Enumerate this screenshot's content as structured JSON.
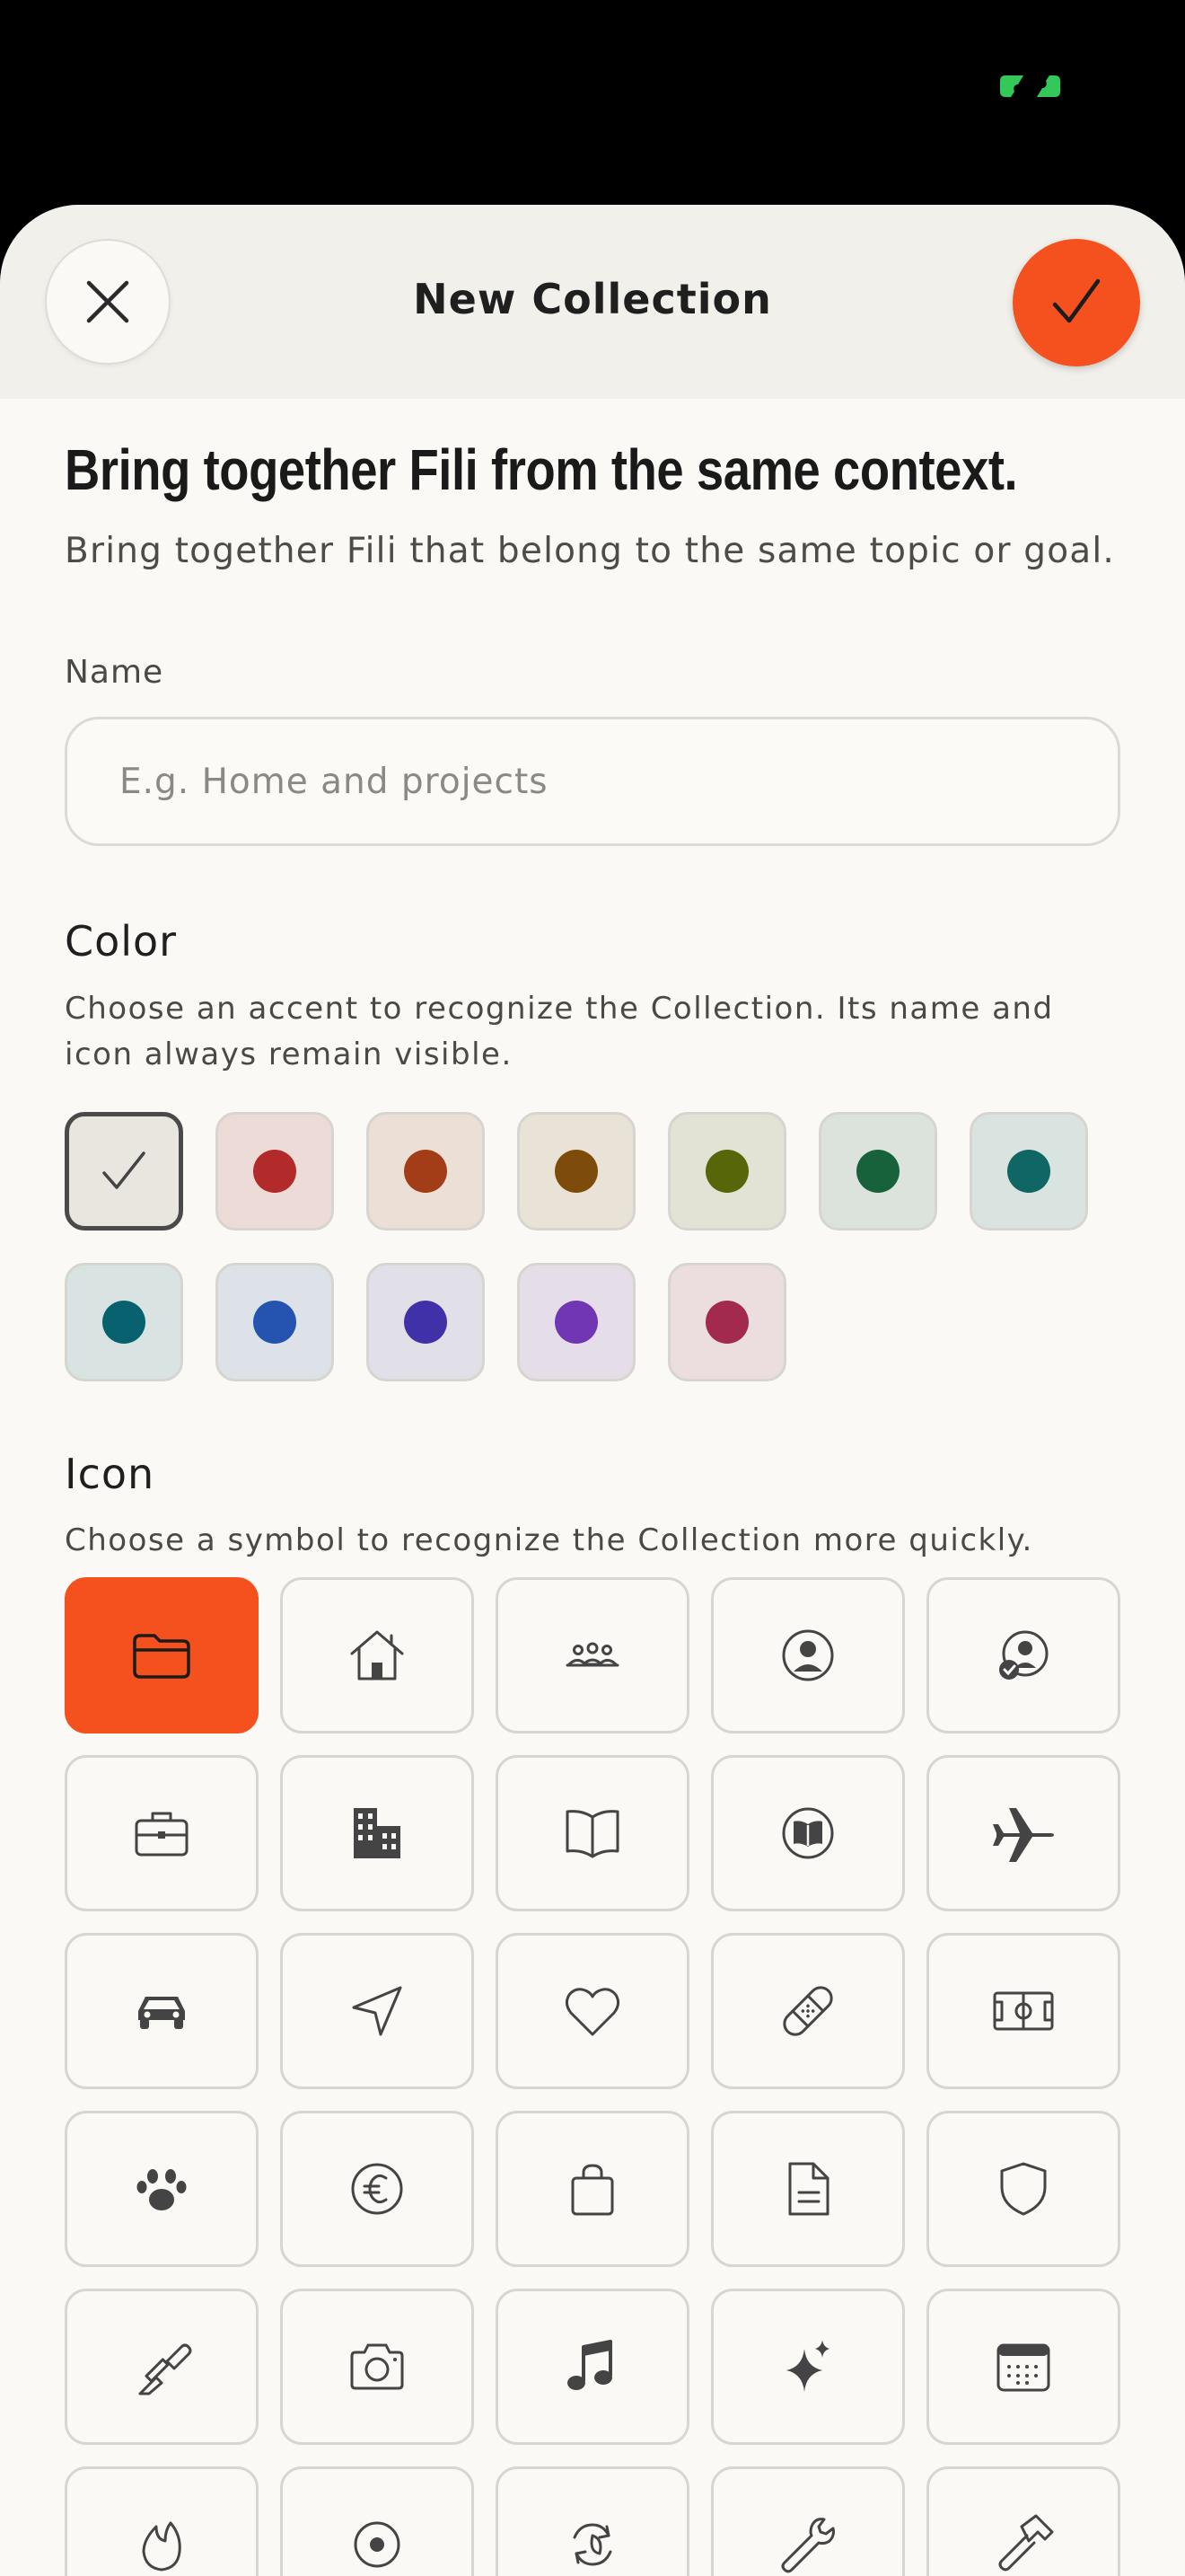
{
  "header": {
    "title": "New Collection",
    "close_icon": "close-icon",
    "confirm_icon": "checkmark-icon"
  },
  "intro": {
    "headline": "Bring together Fili from the same context.",
    "subtitle": "Bring together Fili that belong to the same topic or goal."
  },
  "name_field": {
    "label": "Name",
    "placeholder": "E.g. Home and projects",
    "value": ""
  },
  "color_section": {
    "title": "Color",
    "description": "Choose an accent to recognize the Collection. Its name and icon always remain visible.",
    "selected_index": 0,
    "swatches": [
      {
        "name": "none",
        "bg": "#e9e6df",
        "dot": ""
      },
      {
        "name": "red",
        "bg": "#ecdbd6",
        "dot": "#b22a2a"
      },
      {
        "name": "rust",
        "bg": "#ecdfd5",
        "dot": "#a33d17"
      },
      {
        "name": "brown",
        "bg": "#e9e2d6",
        "dot": "#7d4c0a"
      },
      {
        "name": "olive",
        "bg": "#e2e3d4",
        "dot": "#566608"
      },
      {
        "name": "green",
        "bg": "#dce3dc",
        "dot": "#17623b"
      },
      {
        "name": "teal",
        "bg": "#d9e3df",
        "dot": "#0f6664"
      },
      {
        "name": "petrol",
        "bg": "#d8e3e2",
        "dot": "#08616f"
      },
      {
        "name": "blue",
        "bg": "#dde1e8",
        "dot": "#2554b0"
      },
      {
        "name": "indigo",
        "bg": "#e1dfe8",
        "dot": "#4131a8"
      },
      {
        "name": "purple",
        "bg": "#e5dee8",
        "dot": "#7036b3"
      },
      {
        "name": "crimson",
        "bg": "#ecdedf",
        "dot": "#a32a4f"
      }
    ]
  },
  "icon_section": {
    "title": "Icon",
    "description": "Choose a symbol to recognize the Collection more quickly.",
    "selected_index": 0,
    "icons": [
      "folder-icon",
      "home-icon",
      "group-icon",
      "user-circle-icon",
      "user-check-icon",
      "briefcase-icon",
      "building-icon",
      "book-open-icon",
      "book-circle-icon",
      "airplane-icon",
      "car-icon",
      "navigation-icon",
      "heart-icon",
      "bandage-icon",
      "soccer-field-icon",
      "paw-icon",
      "euro-icon",
      "shopping-bag-icon",
      "document-icon",
      "shield-icon",
      "paintbrush-icon",
      "camera-icon",
      "music-note-icon",
      "sparkles-icon",
      "calendar-icon",
      "flame-icon",
      "target-icon",
      "recycle-icon",
      "wrench-icon",
      "hammer-icon"
    ]
  },
  "colors": {
    "accent": "#f4511e",
    "sheet_background": "#faf9f5",
    "header_background": "#f1f0eb",
    "status_indicator": "#34c759"
  }
}
